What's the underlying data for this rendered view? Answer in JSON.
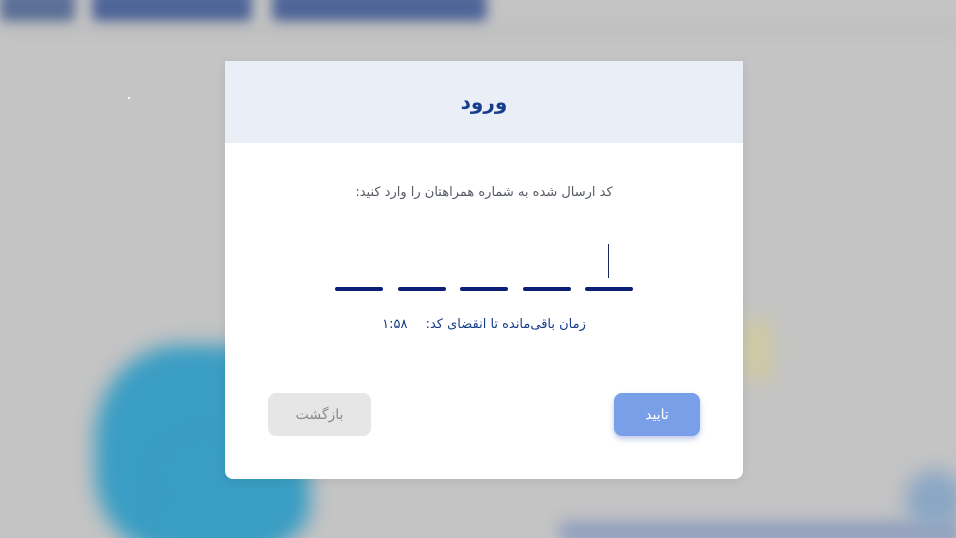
{
  "modal": {
    "title": "ورود",
    "instruction": "کد ارسال شده به شماره همراهتان را وارد کنید:",
    "otp": {
      "length": 5,
      "values": [
        "",
        "",
        "",
        "",
        ""
      ],
      "active_index": 4
    },
    "timer": {
      "label": "زمان باقی‌مانده تا انقضای کد:",
      "value": "۱:۵۸"
    },
    "buttons": {
      "confirm_label": "تایید",
      "back_label": "بازگشت"
    }
  },
  "colors": {
    "title": "#173c8b",
    "header_bg": "#e9eef7",
    "otp_line": "#0b1f78",
    "confirm_bg": "#789fe8",
    "back_bg": "#e6e6e6"
  }
}
